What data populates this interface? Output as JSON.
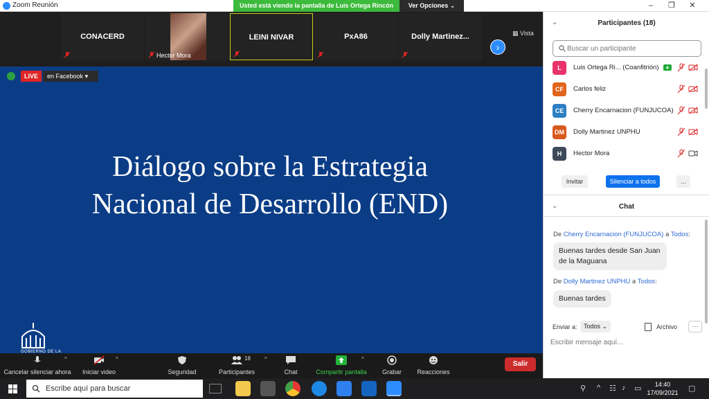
{
  "window": {
    "title": "Zoom Reunión",
    "share_banner": "Usted está viendo la pantalla de Luis Ortega Rincón",
    "view_options": "Ver Opciones",
    "minimize": "–",
    "maximize": "❐",
    "close": "✕"
  },
  "video_strip": {
    "tiles": [
      {
        "name": "CONACERD"
      },
      {
        "name": "Hector Mora"
      },
      {
        "name": "LEINI NIVAR"
      },
      {
        "name": "PxA86"
      },
      {
        "name": "Dolly  Martinez..."
      }
    ],
    "next_symbol": "›",
    "view_label": "Vista"
  },
  "live": {
    "badge": "LIVE",
    "target": "en Facebook"
  },
  "slide": {
    "title_line1": "Diálogo sobre la Estrategia",
    "title_line2": "Nacional de Desarrollo (END)",
    "logo_text": "GOBIERNO DE LA"
  },
  "toolbar": {
    "items": [
      {
        "label": "Cancelar silenciar ahora"
      },
      {
        "label": "Iniciar video"
      },
      {
        "label": "Seguridad"
      },
      {
        "label": "Participantes"
      },
      {
        "label": "Chat"
      },
      {
        "label": "Compartir pantalla"
      },
      {
        "label": "Grabar"
      },
      {
        "label": "Reacciones"
      }
    ],
    "participants_count": "18",
    "leave": "Salir",
    "caret": "^"
  },
  "participants": {
    "title": "Participantes (18)",
    "search_placeholder": "Buscar un participante",
    "list": [
      {
        "initials": "L",
        "name": "Luis Ortega Ri...  (Coanfitrión)",
        "color": "#e8336b",
        "cohost": true
      },
      {
        "initials": "CF",
        "name": "Carlos feliz",
        "color": "#e0641b"
      },
      {
        "initials": "CE",
        "name": "Cherry Encarnacion (FUNJUCOA)",
        "color": "#2d7fc1"
      },
      {
        "initials": "DM",
        "name": "Dolly Martinez UNPHU",
        "color": "#d8591c"
      },
      {
        "initials": "H",
        "name": "Hector Mora",
        "color": "#3d4a5a"
      }
    ],
    "invite": "Invitar",
    "mute_all": "Silenciar a todos",
    "more": "..."
  },
  "chat": {
    "title": "Chat",
    "messages": [
      {
        "prefix": "De ",
        "from": "Cherry Encarnacion (FUNJUCOA)",
        "mid": " a ",
        "to": "Todos",
        "suffix": ":",
        "text": "Buenas tardes desde San Juan de la Maguana"
      },
      {
        "prefix": "De ",
        "from": "Dolly Martinez UNPHU",
        "mid": " a ",
        "to": "Todos",
        "suffix": ":",
        "text": "Buenas tardes"
      }
    ],
    "send_to_label": "Enviar a:",
    "send_to_value": "Todos",
    "file_label": "Archivo",
    "more": "···",
    "input_placeholder": "Escribir mensaje aquí..."
  },
  "taskbar": {
    "search_placeholder": "Escribe aquí para buscar",
    "time": "14:40",
    "date": "17/09/2021"
  }
}
